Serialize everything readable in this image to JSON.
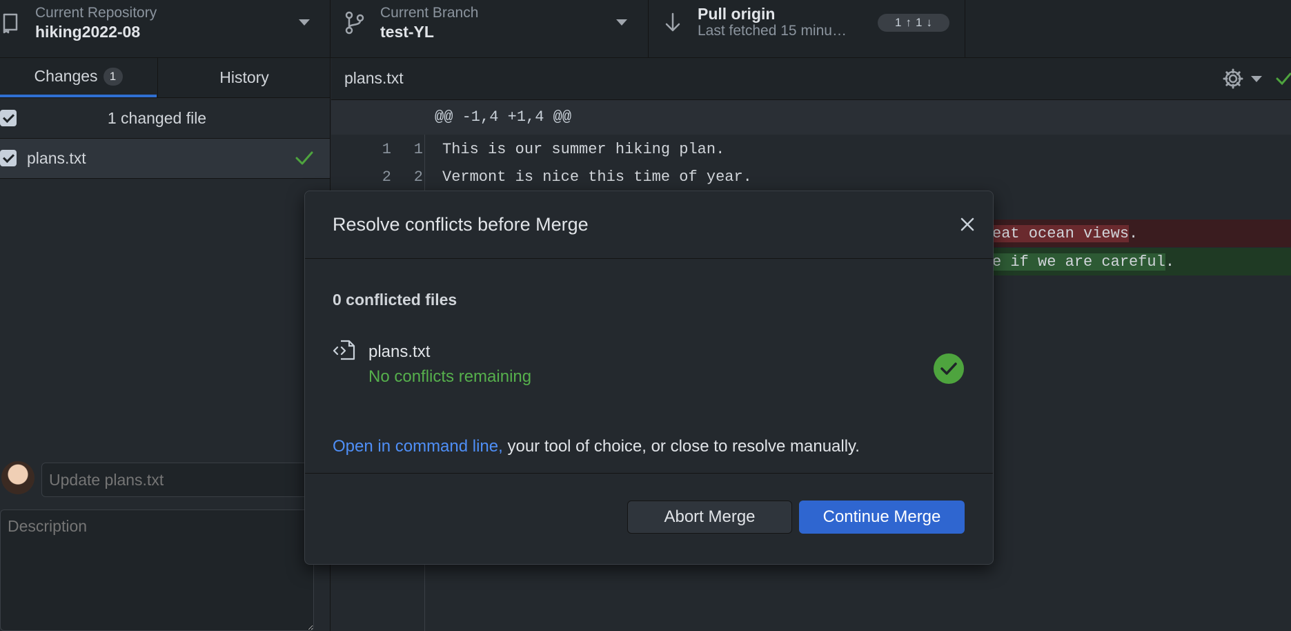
{
  "toolbar": {
    "repo_title": "Current Repository",
    "repo_name": "hiking2022-08",
    "branch_title": "Current Branch",
    "branch_name": "test-YL",
    "pull_title": "Pull origin",
    "pull_sub": "Last fetched 15 minu…",
    "ahead": "1",
    "behind": "1"
  },
  "left": {
    "tab_changes": "Changes",
    "changes_count": "1",
    "tab_history": "History",
    "changed_summary": "1 changed file",
    "file_name": "plans.txt",
    "summary_placeholder": "Update plans.txt",
    "description_placeholder": "Description"
  },
  "diff": {
    "file_name": "plans.txt",
    "hunk": "@@ -1,4 +1,4 @@",
    "lines": [
      {
        "old": "1",
        "new": "1",
        "text": "This is our summer hiking plan."
      },
      {
        "old": "2",
        "new": "2",
        "text": "Vermont is nice this time of year."
      }
    ],
    "removed_tail_pre": "",
    "removed_tail_hl": "eat ocean views",
    "removed_tail_post": ".",
    "added_tail_pre": "",
    "added_tail_hl": "e if we are careful",
    "added_tail_post": "."
  },
  "modal": {
    "title": "Resolve conflicts before Merge",
    "conflict_count": "0 conflicted files",
    "file_name": "plans.txt",
    "file_status": "No conflicts remaining",
    "help_link": "Open in command line,",
    "help_rest": " your tool of choice, or close to resolve manually.",
    "abort_label": "Abort Merge",
    "continue_label": "Continue Merge"
  },
  "colors": {
    "accent": "#2f66d0",
    "success": "#4ea43e",
    "link": "#4f8ff7"
  }
}
